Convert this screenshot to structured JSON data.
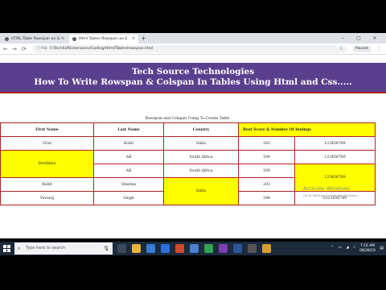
{
  "browser": {
    "tabs": [
      {
        "title": "HTML Table Rowspan an & Cols",
        "close": "×"
      },
      {
        "title": "Html Tables Rowspan an & Colsp",
        "close": "×"
      }
    ],
    "new_tab": "+",
    "window_controls": {
      "minimize": "–",
      "maximize": "▢",
      "close": "×"
    },
    "nav": {
      "back": "←",
      "forward": "→",
      "reload": "⟳"
    },
    "address": {
      "info": "ⓘ File",
      "url": "F:/TechSoftExtensions/Coding/Html/Tables/rowspan.html"
    },
    "profile": "Paused",
    "menu": "⋮"
  },
  "page": {
    "banner_title": "Tech Source Technologies",
    "banner_subtitle": "How To Write Rowspan & Colspan In Tables Using Html and Css.....",
    "caption": "Rowspan and Colspan Using To Create Table",
    "table": {
      "headers": [
        "First Name",
        "Last Name",
        "Country",
        "Best Score & Number Of Innings"
      ],
      "rows": {
        "r1": {
          "first": "Virat",
          "last": "Kohli",
          "country": "India",
          "score": "183",
          "innings": "123456789"
        },
        "r2": {
          "first": "Devilliers",
          "last": "AB",
          "country": "South Africa",
          "score": "190",
          "innings": "123456789"
        },
        "r3": {
          "last": "AB",
          "country": "South Africa",
          "score": "190"
        },
        "r4": {
          "first": "Rohit",
          "last": "Sharma",
          "country": "India",
          "score": "203",
          "innings": "123456789"
        },
        "r5": {
          "first": "Yuvaraj",
          "last": "Singh",
          "score": "198",
          "innings": "0123456789"
        }
      }
    }
  },
  "watermark": {
    "title": "Activate Windows",
    "subtitle": "Go to Settings to activate Windows."
  },
  "taskbar": {
    "search_placeholder": "Type here to search",
    "time": "7:16 AM",
    "date": "08/28/19"
  },
  "colors": {
    "banner": "#5b3f8f",
    "highlight": "#ffff00",
    "border": "#b22222",
    "taskbar": "#1b2b3c"
  }
}
